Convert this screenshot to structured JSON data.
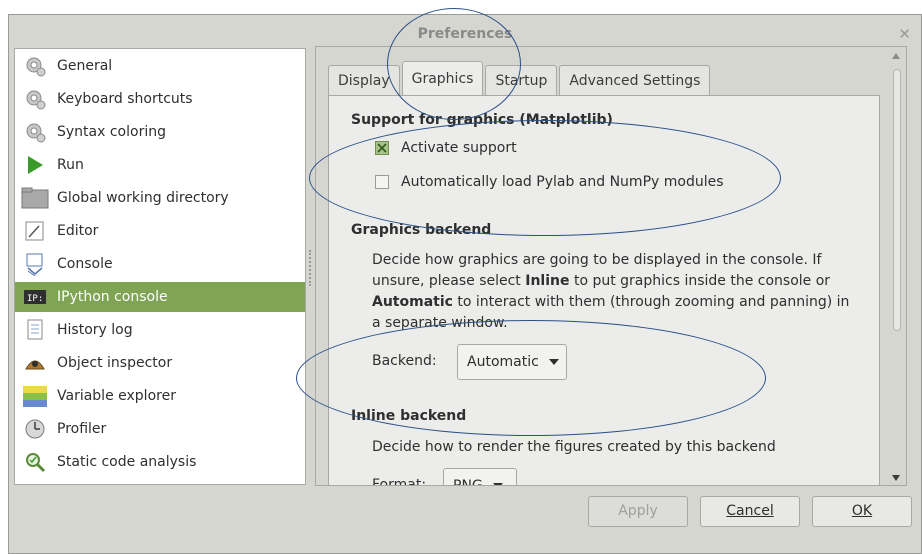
{
  "window": {
    "title": "Preferences",
    "close_glyph": "✕"
  },
  "sidebar": {
    "items": [
      {
        "label": "General",
        "icon": "gear-icon"
      },
      {
        "label": "Keyboard shortcuts",
        "icon": "gear-icon"
      },
      {
        "label": "Syntax coloring",
        "icon": "gear-icon"
      },
      {
        "label": "Run",
        "icon": "play-icon"
      },
      {
        "label": "Global working directory",
        "icon": "folder-icon"
      },
      {
        "label": "Editor",
        "icon": "editor-icon"
      },
      {
        "label": "Console",
        "icon": "console-icon"
      },
      {
        "label": "IPython console",
        "icon": "ipython-icon"
      },
      {
        "label": "History log",
        "icon": "history-icon"
      },
      {
        "label": "Object inspector",
        "icon": "inspector-icon"
      },
      {
        "label": "Variable explorer",
        "icon": "variables-icon"
      },
      {
        "label": "Profiler",
        "icon": "profiler-icon"
      },
      {
        "label": "Static code analysis",
        "icon": "analysis-icon"
      }
    ],
    "selected_index": 7,
    "selected_color": "#7ea454"
  },
  "tabs": [
    {
      "label": "Display"
    },
    {
      "label": "Graphics"
    },
    {
      "label": "Startup"
    },
    {
      "label": "Advanced Settings"
    }
  ],
  "graphics": {
    "support_heading": "Support for graphics (Matplotlib)",
    "activate_label": "Activate support",
    "activate_checked": true,
    "autoload_label": "Automatically load Pylab and NumPy modules",
    "autoload_checked": false,
    "backend_heading": "Graphics backend",
    "backend_desc_1": "Decide how graphics are going to be displayed in the console. If unsure, please select ",
    "backend_desc_bold1": "Inline",
    "backend_desc_2": " to put graphics inside the console or ",
    "backend_desc_bold2": "Automatic",
    "backend_desc_3": " to interact with them (through zooming and panning) in a separate window.",
    "backend_label": "Backend:",
    "backend_value": "Automatic",
    "inline_heading": "Inline backend",
    "inline_desc": "Decide how to render the figures created by this backend",
    "format_label": "Format:",
    "format_value": "PNG"
  },
  "buttons": {
    "apply": "Apply",
    "cancel": "Cancel",
    "ok": "OK"
  },
  "annotation_color": "#2a4f8a"
}
